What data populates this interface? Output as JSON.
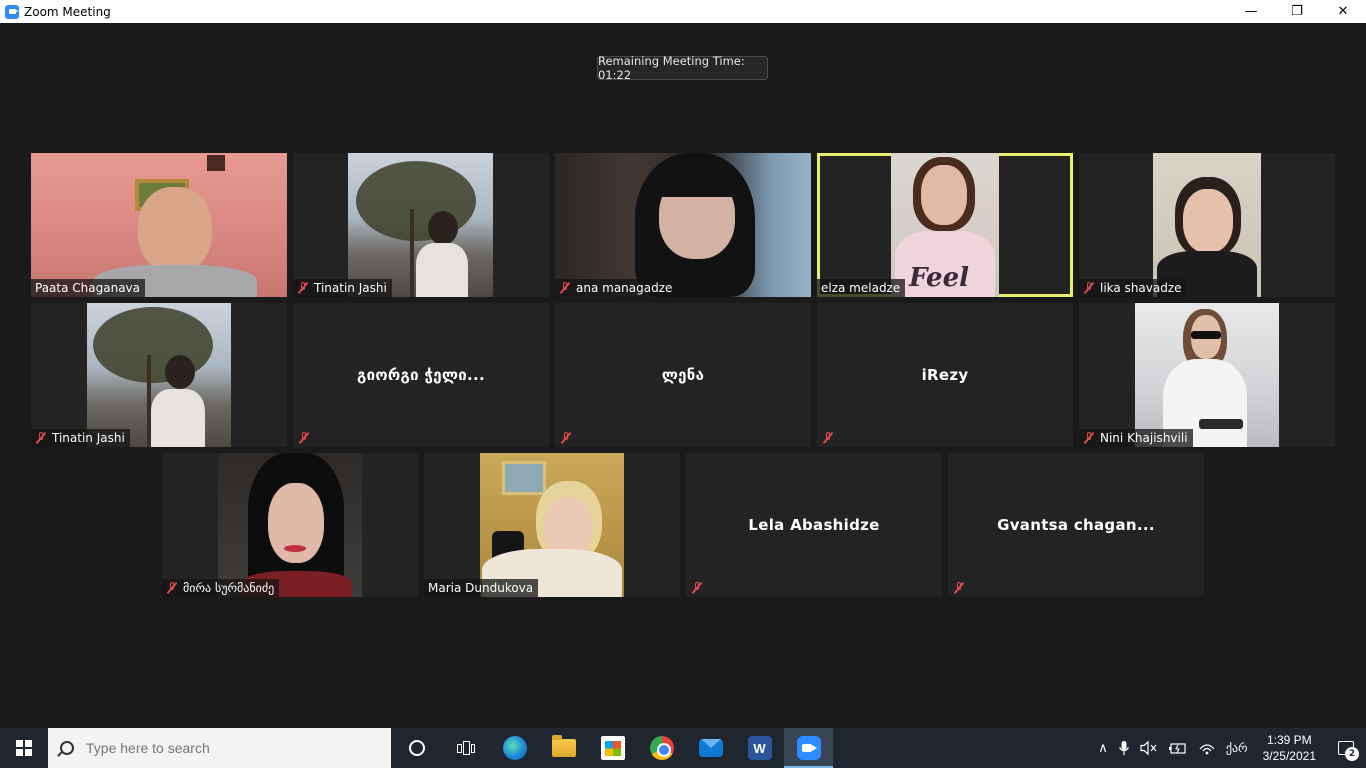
{
  "window": {
    "title": "Zoom Meeting",
    "minimize_glyph": "—",
    "restore_glyph": "❐",
    "close_glyph": "✕"
  },
  "meeting": {
    "timer_text": "Remaining Meeting Time: 01:22"
  },
  "participants": [
    {
      "name": "Paata Chaganava",
      "muted": false,
      "video": true,
      "active": false
    },
    {
      "name": "Tinatin Jashi",
      "muted": true,
      "video": true,
      "active": false
    },
    {
      "name": "ana managadze",
      "muted": true,
      "video": true,
      "active": false
    },
    {
      "name": "elza meladze",
      "muted": false,
      "video": true,
      "active": true
    },
    {
      "name": "lika shavadze",
      "muted": true,
      "video": true,
      "active": false
    },
    {
      "name": "Tinatin Jashi",
      "muted": true,
      "video": true,
      "active": false
    },
    {
      "name": "გიორგი ჭელი...",
      "muted": true,
      "video": false,
      "active": false
    },
    {
      "name": "ლენა",
      "muted": true,
      "video": false,
      "active": false
    },
    {
      "name": "iRezy",
      "muted": true,
      "video": false,
      "active": false
    },
    {
      "name": "Nini Khajishvili",
      "muted": true,
      "video": true,
      "active": false
    },
    {
      "name": "მირა სურმანიძე",
      "muted": true,
      "video": true,
      "active": false
    },
    {
      "name": "Maria Dundukova",
      "muted": false,
      "video": true,
      "active": false
    },
    {
      "name": "Lela Abashidze",
      "muted": true,
      "video": false,
      "active": false
    },
    {
      "name": "Gvantsa chagan...",
      "muted": true,
      "video": false,
      "active": false
    }
  ],
  "video_overlay_text": "Feel",
  "taskbar": {
    "search_placeholder": "Type here to search",
    "pinned": [
      {
        "name": "cortana-icon"
      },
      {
        "name": "task-view-icon"
      },
      {
        "name": "edge-icon"
      },
      {
        "name": "file-explorer-icon"
      },
      {
        "name": "microsoft-store-icon"
      },
      {
        "name": "chrome-icon"
      },
      {
        "name": "mail-icon"
      },
      {
        "name": "word-icon",
        "label": "W"
      },
      {
        "name": "zoom-icon"
      }
    ],
    "tray": {
      "chevron": "∧",
      "language": "ქარ",
      "time": "1:39 PM",
      "date": "3/25/2021",
      "notification_count": "2"
    }
  }
}
